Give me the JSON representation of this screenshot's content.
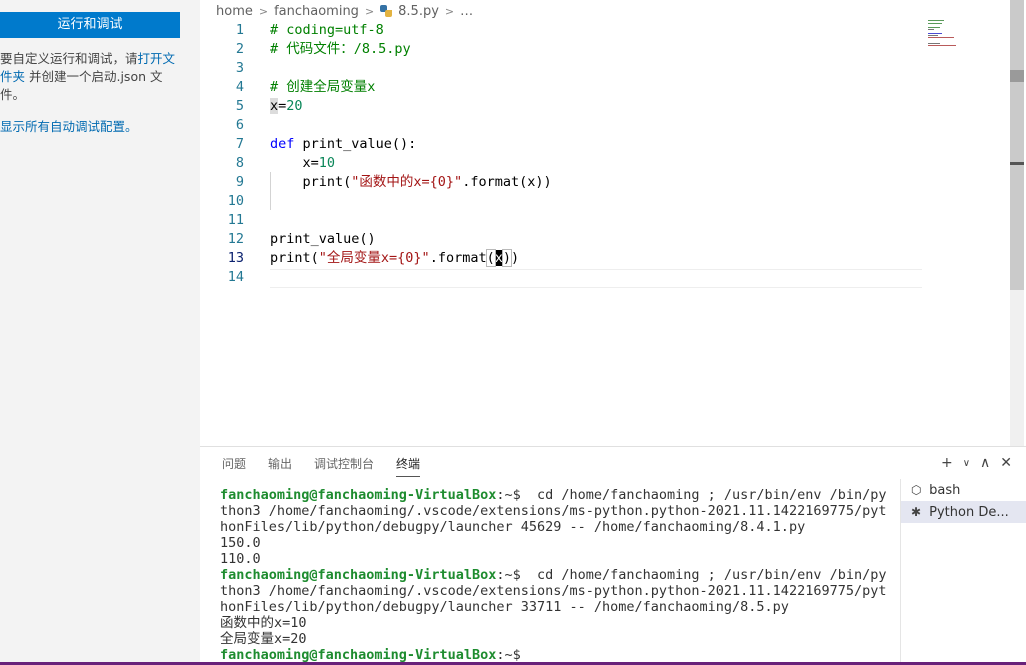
{
  "sidebar": {
    "run_button": "运行和调试",
    "text_prefix": "要自定义运行和调试，请",
    "open_folder_link": "打开文件夹",
    "text_suffix": " 并创建一个启动.json 文件。",
    "show_all_link": "显示所有自动调试配置。"
  },
  "breadcrumb": {
    "items": [
      "home",
      "fanchaoming",
      "8.5.py",
      "…"
    ]
  },
  "editor": {
    "line_numbers": [
      "1",
      "2",
      "3",
      "4",
      "5",
      "6",
      "7",
      "8",
      "9",
      "10",
      "11",
      "12",
      "13",
      "14"
    ],
    "lines": [
      "# coding=utf-8",
      "# 代码文件：/8.5.py",
      "",
      "# 创建全局变量x",
      "x=20",
      "",
      "def print_value():",
      "    x=10",
      "    print(\"函数中的x={0}\".format(x))",
      "",
      "",
      "print_value()",
      "print(\"全局变量x={0}\".format(x))",
      ""
    ]
  },
  "panel": {
    "tabs": [
      "问题",
      "输出",
      "调试控制台",
      "终端"
    ],
    "active_tab": "终端",
    "actions": [
      "+",
      "∨",
      "∧",
      "✕"
    ],
    "terminal_lines": [
      {
        "prompt": "fanchaoming@fanchaoming-VirtualBox",
        "rest": ":~$  cd /home/fanchaoming ; /usr/bin/env /bin/py"
      },
      {
        "text": "thon3 /home/fanchaoming/.vscode/extensions/ms-python.python-2021.11.1422169775/pyt"
      },
      {
        "text": "honFiles/lib/python/debugpy/launcher 45629 -- /home/fanchaoming/8.4.1.py"
      },
      {
        "text": "150.0"
      },
      {
        "text": "110.0"
      },
      {
        "prompt": "fanchaoming@fanchaoming-VirtualBox",
        "rest": ":~$  cd /home/fanchaoming ; /usr/bin/env /bin/py"
      },
      {
        "text": "thon3 /home/fanchaoming/.vscode/extensions/ms-python.python-2021.11.1422169775/pyt"
      },
      {
        "text": "honFiles/lib/python/debugpy/launcher 33711 -- /home/fanchaoming/8.5.py"
      },
      {
        "text": "函数中的x=10"
      },
      {
        "text": "全局变量x=20"
      },
      {
        "prompt": "fanchaoming@fanchaoming-VirtualBox",
        "rest": ":~$ "
      }
    ],
    "terminals": [
      {
        "label": "bash",
        "icon": "bash-icon"
      },
      {
        "label": "Python De...",
        "icon": "debug-icon"
      }
    ]
  },
  "colors": {
    "accent": "#007acc",
    "prompt": "#1e8c2f",
    "comment": "#008000",
    "keyword": "#0000ff",
    "string": "#a31515",
    "number": "#098658"
  }
}
